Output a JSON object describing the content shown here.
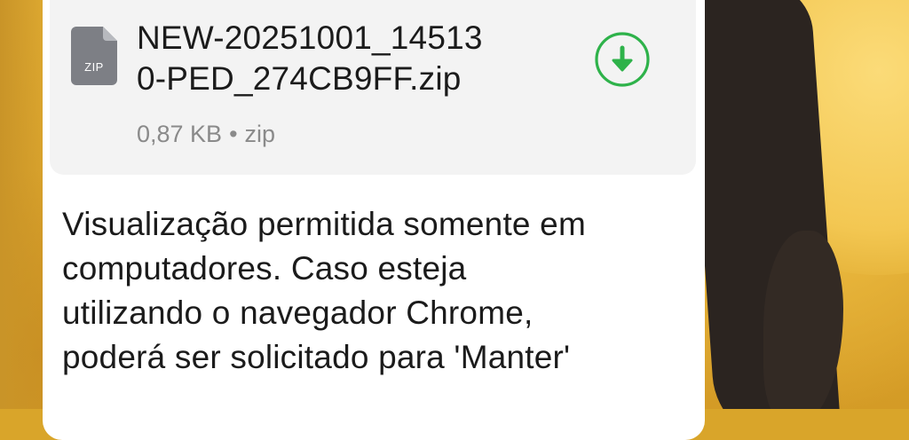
{
  "file": {
    "name_line1": "NEW-20251001_14513",
    "name_line2": "0-PED_274CB9FF.zip",
    "size": "0,87 KB",
    "separator": "•",
    "type": "zip",
    "icon_label": "ZIP",
    "icon": "zip-file-icon",
    "download_icon": "download-icon"
  },
  "message": {
    "lines": [
      "Visualização permitida somente em",
      "computadores. Caso esteja",
      "utilizando o navegador Chrome,",
      "poderá ser solicitado para 'Manter'"
    ]
  },
  "colors": {
    "bubble": "#ffffff",
    "file_card": "#f3f3f3",
    "accent_green": "#2eb24a",
    "file_icon_gray": "#7d7f85",
    "wallpaper": "#d9a52a"
  }
}
